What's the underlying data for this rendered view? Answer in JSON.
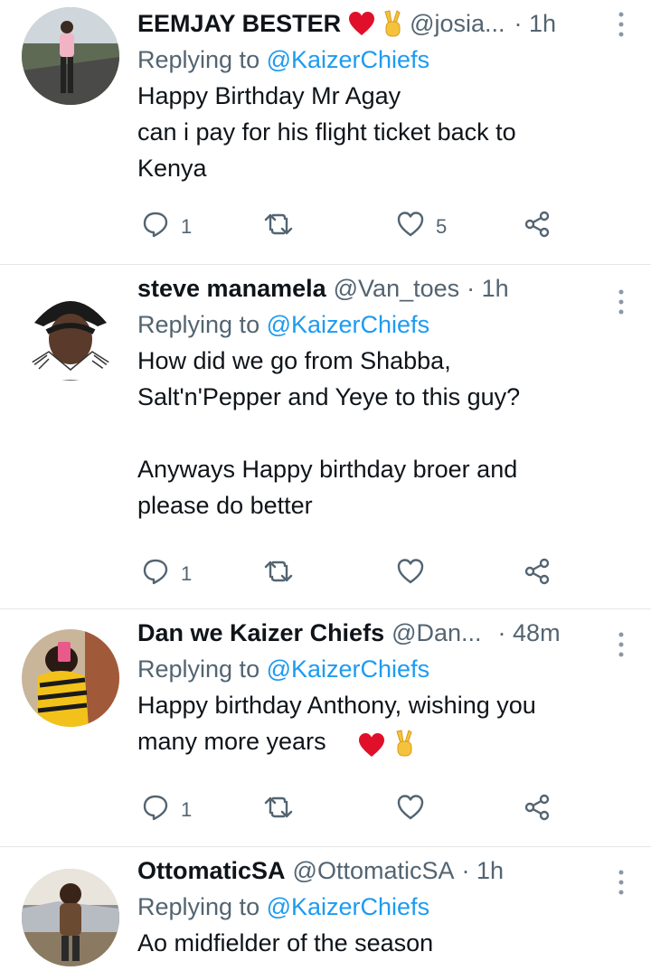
{
  "tweets": [
    {
      "name": "EEMJAY BESTER",
      "name_emojis": [
        "red-heart",
        "victory-hand"
      ],
      "handle": "@josia...",
      "time": "· 1h",
      "replying_prefix": "Replying to ",
      "replying_to": "@KaizerChiefs",
      "text": "Happy Birthday Mr Agay\ncan i pay for his flight ticket back to\nKenya",
      "text_emojis": [],
      "replies": "1",
      "retweets": "",
      "likes": "5"
    },
    {
      "name": "steve manamela",
      "name_emojis": [],
      "handle": "@Van_toes",
      "time": "· 1h",
      "replying_prefix": "Replying to ",
      "replying_to": "@KaizerChiefs",
      "text": "How did we go from Shabba,\nSalt'n'Pepper and Yeye to this guy?\n\nAnyways Happy birthday broer and\nplease do better",
      "text_emojis": [],
      "replies": "1",
      "retweets": "",
      "likes": ""
    },
    {
      "name": "Dan we Kaizer Chiefs",
      "name_emojis": [],
      "handle": "@Dan...",
      "time": "· 48m",
      "replying_prefix": "Replying to ",
      "replying_to": "@KaizerChiefs",
      "text": "Happy birthday Anthony, wishing you\nmany more years",
      "text_emojis": [
        "red-heart",
        "victory-hand"
      ],
      "replies": "1",
      "retweets": "",
      "likes": ""
    },
    {
      "name": "OttomaticSA",
      "name_emojis": [],
      "handle": "@OttomaticSA",
      "time": "· 1h",
      "replying_prefix": "Replying to ",
      "replying_to": "@KaizerChiefs",
      "text": "Ao midfielder of the season",
      "text_emojis": [],
      "replies": "",
      "retweets": "",
      "likes": ""
    }
  ],
  "colors": {
    "link": "#1d9bf0",
    "secondary": "#536471",
    "text": "#0f1419",
    "heart": "#e0102a"
  },
  "icons": [
    "reply-icon",
    "retweet-icon",
    "like-icon",
    "share-icon",
    "more-icon"
  ]
}
